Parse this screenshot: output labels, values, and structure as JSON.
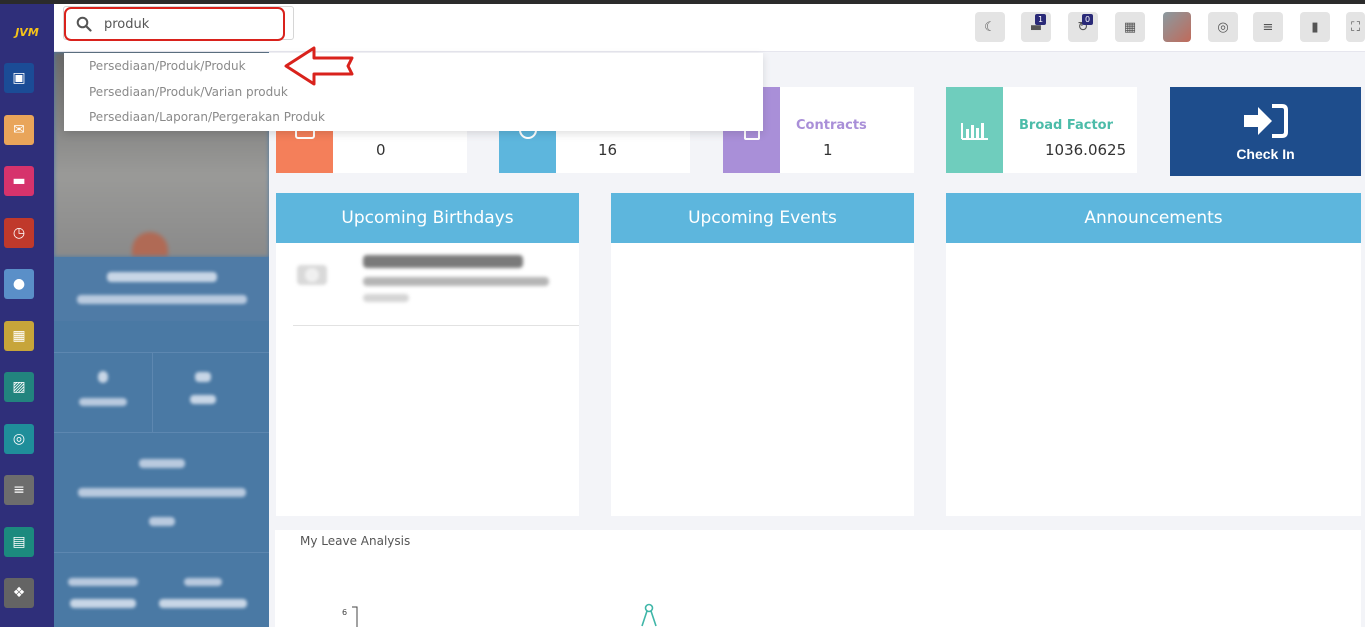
{
  "sidebar": {
    "logo_text": "JVM",
    "items": [
      {
        "icon": "monitor-icon",
        "color": "#1b4c96"
      },
      {
        "icon": "mail-icon",
        "color": "#e9a55a"
      },
      {
        "icon": "chat-icon",
        "color": "#d6336c"
      },
      {
        "icon": "timer-icon",
        "color": "#c0392b"
      },
      {
        "icon": "user-clock-icon",
        "color": "#5a8fc8"
      },
      {
        "icon": "calendar-icon",
        "color": "#c7a53a"
      },
      {
        "icon": "presentation-icon",
        "color": "#22847e"
      },
      {
        "icon": "dashboard-icon",
        "color": "#1f8e9a"
      },
      {
        "icon": "edit-list-icon",
        "color": "#6d6d6d"
      },
      {
        "icon": "contact-icon",
        "color": "#1c8a7e"
      },
      {
        "icon": "puzzle-icon",
        "color": "#646464"
      }
    ]
  },
  "search": {
    "value": "produk",
    "suggestions": [
      "Persediaan/Produk/Produk",
      "Persediaan/Produk/Varian produk",
      "Persediaan/Laporan/Pergerakan Produk"
    ]
  },
  "header_icons": [
    {
      "icon": "moon-icon",
      "badge": ""
    },
    {
      "icon": "messages-icon",
      "badge": "1"
    },
    {
      "icon": "notification-icon",
      "badge": "0"
    },
    {
      "icon": "calculator-icon",
      "badge": ""
    },
    {
      "icon": "user-avatar-icon",
      "badge": ""
    },
    {
      "icon": "globe-icon",
      "badge": ""
    },
    {
      "icon": "menu-icon",
      "badge": ""
    },
    {
      "icon": "bookmark-icon",
      "badge": ""
    },
    {
      "icon": "fullscreen-icon",
      "badge": ""
    }
  ],
  "cards": [
    {
      "label": "",
      "value": "0",
      "color": "#f47f5a"
    },
    {
      "label": "",
      "value": "16",
      "color": "#5db6dd"
    },
    {
      "label": "Contracts",
      "value": "1",
      "color": "#a98fd8",
      "label_color": "#a98fd8"
    },
    {
      "label": "Broad Factor",
      "value": "1036.0625",
      "color": "#6fcdbd",
      "label_color": "#4cbca9"
    }
  ],
  "checkin": {
    "label": "Check In"
  },
  "panels": {
    "birthdays": "Upcoming Birthdays",
    "events": "Upcoming Events",
    "announcements": "Announcements"
  },
  "leave": {
    "title": "My Leave Analysis",
    "tick": "6"
  }
}
